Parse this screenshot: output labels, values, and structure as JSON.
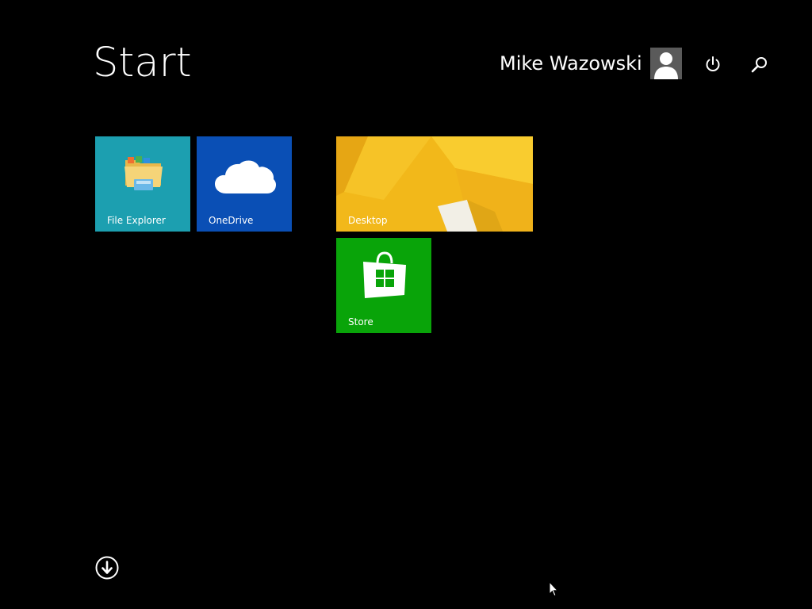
{
  "header": {
    "title": "Start",
    "user_name": "Mike Wazowski",
    "power_icon": "power-icon",
    "search_icon": "search-icon",
    "avatar_icon": "user-silhouette-icon"
  },
  "tiles": [
    {
      "label": "File Explorer",
      "color": "#1c9fb0",
      "icon": "folder-icon"
    },
    {
      "label": "OneDrive",
      "color": "#0a4fb5",
      "icon": "cloud-icon"
    },
    {
      "label": "Desktop",
      "color": "#f2b81a",
      "icon": "desktop-wallpaper"
    },
    {
      "label": "Store",
      "color": "#09a409",
      "icon": "store-bag-icon"
    }
  ],
  "footer": {
    "all_apps_icon": "down-arrow-circle-icon"
  },
  "colors": {
    "background": "#000000",
    "text": "#ffffff",
    "avatar_bg": "#5a5a5a"
  }
}
